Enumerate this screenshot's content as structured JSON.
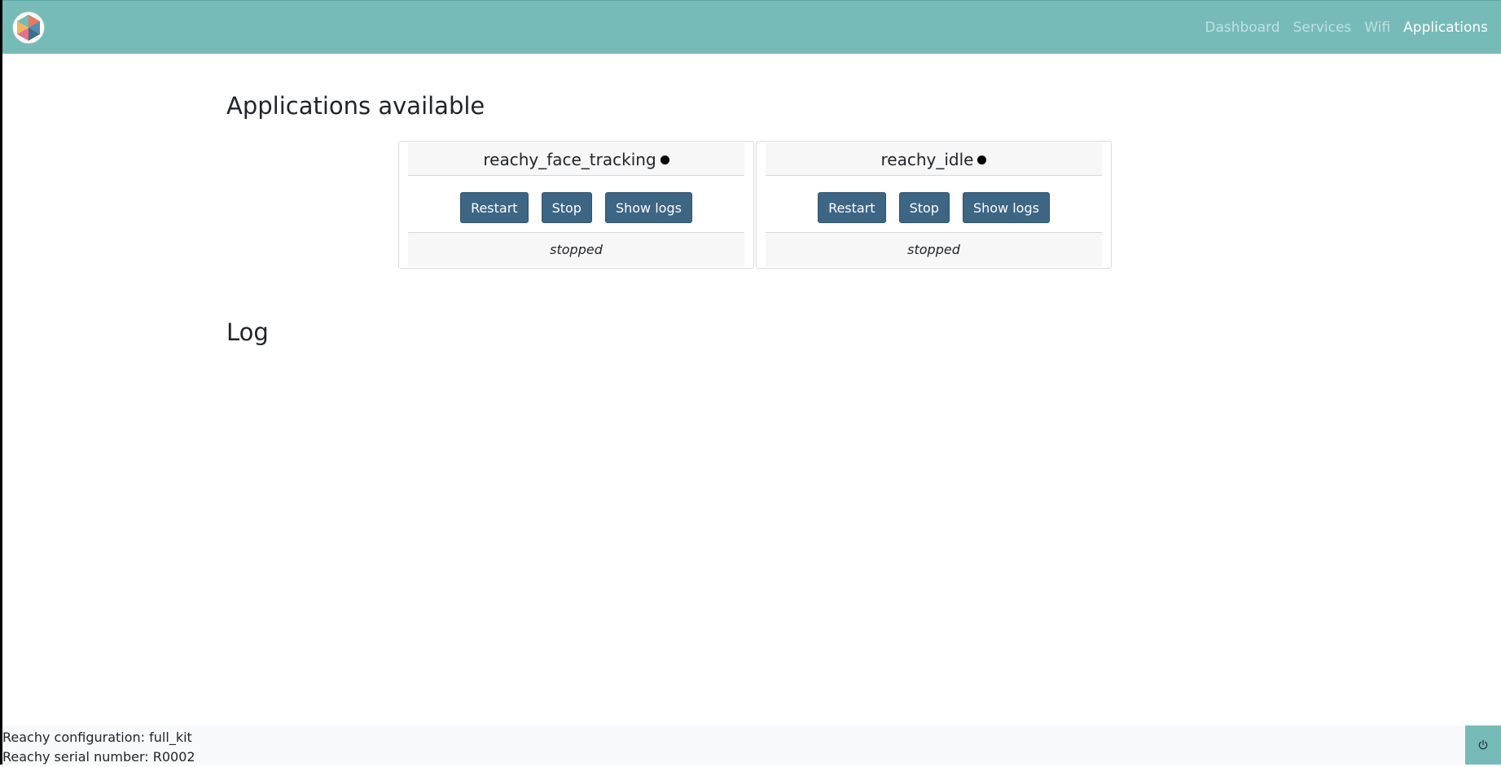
{
  "navbar": {
    "logo": "reachy-logo-icon",
    "links": [
      {
        "label": "Dashboard",
        "active": false
      },
      {
        "label": "Services",
        "active": false
      },
      {
        "label": "Wifi",
        "active": false
      },
      {
        "label": "Applications",
        "active": true
      }
    ]
  },
  "main": {
    "title": "Applications available",
    "apps": [
      {
        "name": "reachy_face_tracking",
        "buttons": {
          "restart": "Restart",
          "stop": "Stop",
          "show_logs": "Show logs"
        },
        "status": "stopped"
      },
      {
        "name": "reachy_idle",
        "buttons": {
          "restart": "Restart",
          "stop": "Stop",
          "show_logs": "Show logs"
        },
        "status": "stopped"
      }
    ],
    "log_title": "Log"
  },
  "footer": {
    "configuration": "Reachy configuration: full_kit",
    "serial": "Reachy serial number: R0002",
    "power_icon": "power-icon"
  },
  "colors": {
    "navbar": "#76bbb7",
    "button": "#3d6584"
  }
}
